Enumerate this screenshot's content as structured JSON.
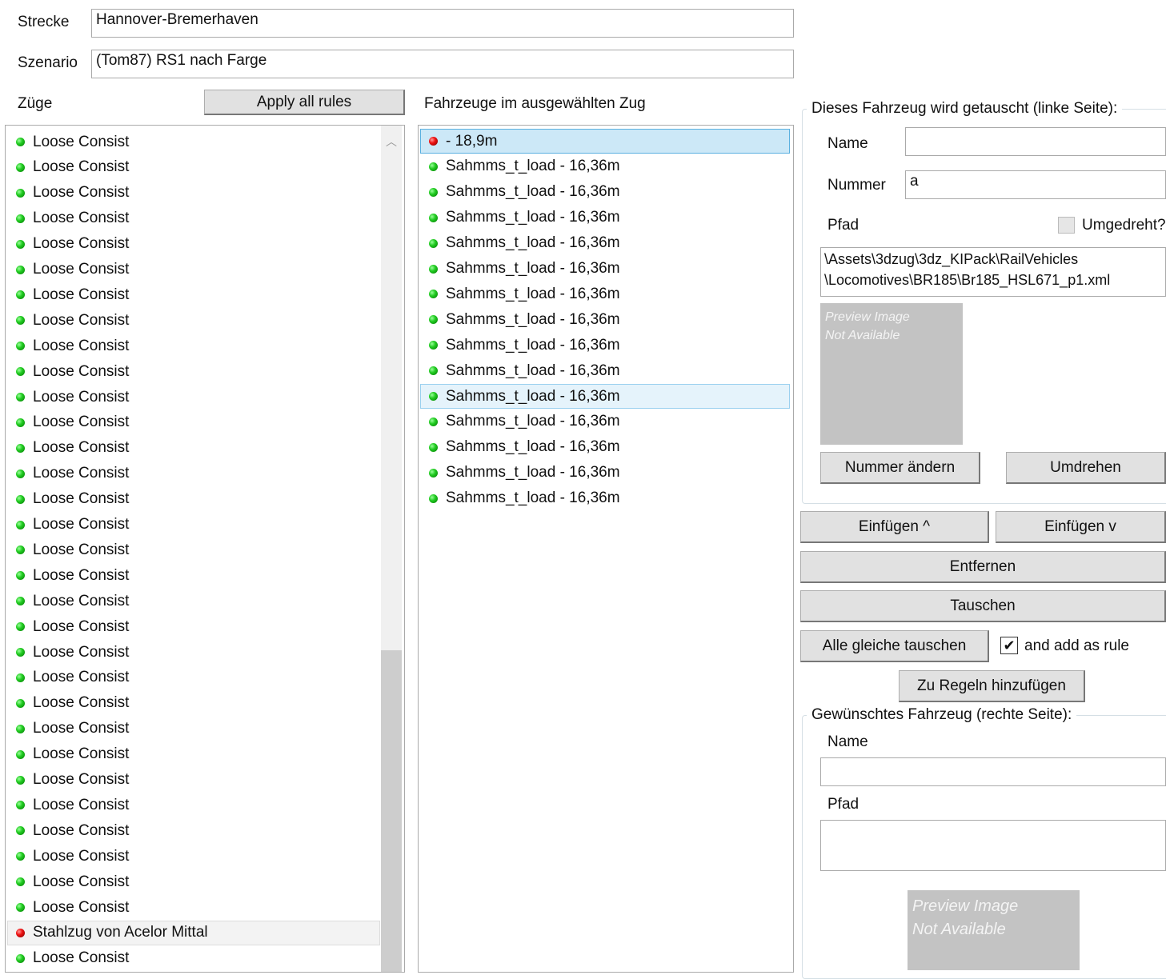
{
  "header": {
    "strecke_label": "Strecke",
    "strecke_value": "Hannover-Bremerhaven",
    "szenario_label": "Szenario",
    "szenario_value": "(Tom87) RS1 nach Farge"
  },
  "trains": {
    "label": "Züge",
    "apply_button": "Apply all rules",
    "items": [
      {
        "name": "Loose Consist",
        "status": "green"
      },
      {
        "name": "Loose Consist",
        "status": "green"
      },
      {
        "name": "Loose Consist",
        "status": "green"
      },
      {
        "name": "Loose Consist",
        "status": "green"
      },
      {
        "name": "Loose Consist",
        "status": "green"
      },
      {
        "name": "Loose Consist",
        "status": "green"
      },
      {
        "name": "Loose Consist",
        "status": "green"
      },
      {
        "name": "Loose Consist",
        "status": "green"
      },
      {
        "name": "Loose Consist",
        "status": "green"
      },
      {
        "name": "Loose Consist",
        "status": "green"
      },
      {
        "name": "Loose Consist",
        "status": "green"
      },
      {
        "name": "Loose Consist",
        "status": "green"
      },
      {
        "name": "Loose Consist",
        "status": "green"
      },
      {
        "name": "Loose Consist",
        "status": "green"
      },
      {
        "name": "Loose Consist",
        "status": "green"
      },
      {
        "name": "Loose Consist",
        "status": "green"
      },
      {
        "name": "Loose Consist",
        "status": "green"
      },
      {
        "name": "Loose Consist",
        "status": "green"
      },
      {
        "name": "Loose Consist",
        "status": "green"
      },
      {
        "name": "Loose Consist",
        "status": "green"
      },
      {
        "name": "Loose Consist",
        "status": "green"
      },
      {
        "name": "Loose Consist",
        "status": "green"
      },
      {
        "name": "Loose Consist",
        "status": "green"
      },
      {
        "name": "Loose Consist",
        "status": "green"
      },
      {
        "name": "Loose Consist",
        "status": "green"
      },
      {
        "name": "Loose Consist",
        "status": "green"
      },
      {
        "name": "Loose Consist",
        "status": "green"
      },
      {
        "name": "Loose Consist",
        "status": "green"
      },
      {
        "name": "Loose Consist",
        "status": "green"
      },
      {
        "name": "Loose Consist",
        "status": "green"
      },
      {
        "name": "Loose Consist",
        "status": "green"
      },
      {
        "name": "Stahlzug von Acelor Mittal",
        "status": "red",
        "selected": true
      },
      {
        "name": "Loose Consist",
        "status": "green"
      }
    ]
  },
  "vehicles": {
    "label": "Fahrzeuge im ausgewählten Zug",
    "items": [
      {
        "name": " - 18,9m",
        "status": "red",
        "state": "selected"
      },
      {
        "name": "Sahmms_t_load - 16,36m",
        "status": "green"
      },
      {
        "name": "Sahmms_t_load - 16,36m",
        "status": "green"
      },
      {
        "name": "Sahmms_t_load - 16,36m",
        "status": "green"
      },
      {
        "name": "Sahmms_t_load - 16,36m",
        "status": "green"
      },
      {
        "name": "Sahmms_t_load - 16,36m",
        "status": "green"
      },
      {
        "name": "Sahmms_t_load - 16,36m",
        "status": "green"
      },
      {
        "name": "Sahmms_t_load - 16,36m",
        "status": "green"
      },
      {
        "name": "Sahmms_t_load - 16,36m",
        "status": "green"
      },
      {
        "name": "Sahmms_t_load - 16,36m",
        "status": "green"
      },
      {
        "name": "Sahmms_t_load - 16,36m",
        "status": "green",
        "state": "hover"
      },
      {
        "name": "Sahmms_t_load - 16,36m",
        "status": "green"
      },
      {
        "name": "Sahmms_t_load - 16,36m",
        "status": "green"
      },
      {
        "name": "Sahmms_t_load - 16,36m",
        "status": "green"
      },
      {
        "name": "Sahmms_t_load - 16,36m",
        "status": "green"
      }
    ]
  },
  "left_side": {
    "title": "Dieses Fahrzeug wird getauscht (linke Seite):",
    "name_label": "Name",
    "name_value": "",
    "nummer_label": "Nummer",
    "nummer_value": "a",
    "pfad_label": "Pfad",
    "umgedreht_label": "Umgedreht?",
    "umgedreht_checked": false,
    "pfad_value_line1": "\\Assets\\3dzug\\3dz_KIPack\\RailVehicles",
    "pfad_value_line2": "\\Locomotives\\BR185\\Br185_HSL671_p1.xml",
    "preview_line1": "Preview Image",
    "preview_line2": "Not Available",
    "nummer_button": "Nummer ändern",
    "umdrehen_button": "Umdrehen"
  },
  "actions": {
    "insert_up": "Einfügen ^",
    "insert_down": "Einfügen v",
    "remove": "Entfernen",
    "swap": "Tauschen",
    "swap_all": "Alle gleiche tauschen",
    "add_rule_label": "and add as rule",
    "add_rule_checked": true,
    "add_to_rules": "Zu Regeln hinzufügen"
  },
  "right_side": {
    "title": "Gewünschtes Fahrzeug (rechte Seite):",
    "name_label": "Name",
    "name_value": "",
    "pfad_label": "Pfad",
    "pfad_value": "",
    "preview_line1": "Preview Image",
    "preview_line2": "Not Available"
  }
}
